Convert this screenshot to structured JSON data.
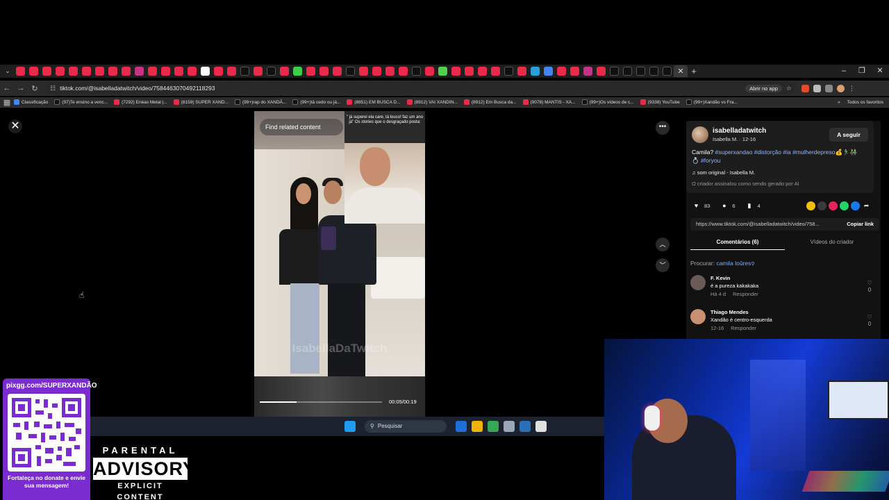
{
  "browser": {
    "url": "tiktok.com/@isabelladatwitch/video/7584463070492118293",
    "open_app_label": "Abrir no app",
    "tab_colors": [
      "#ea2a4a",
      "#ea2a4a",
      "#ea2a4a",
      "#ea2a4a",
      "#ea2a4a",
      "#ea2a4a",
      "#ea2a4a",
      "#ea2a4a",
      "#ea2a4a",
      "#c13584",
      "#ea2a4a",
      "#ea2a4a",
      "#ea2a4a",
      "#ea2a4a",
      "#ffffff",
      "#ea2a4a",
      "#ea2a4a",
      "#111111",
      "#ea2a4a",
      "#111111",
      "#ea2a4a",
      "#3ecf4a",
      "#ea2a4a",
      "#ea2a4a",
      "#ea2a4a",
      "#111111",
      "#ea2a4a",
      "#ea2a4a",
      "#ea2a4a",
      "#ea2a4a",
      "#111111",
      "#ea2a4a",
      "#52d04b",
      "#ea2a4a",
      "#ea2a4a",
      "#ea2a4a",
      "#ea2a4a",
      "#111111",
      "#ea2a4a",
      "#2a9fd8",
      "#4285f4",
      "#ea2a4a",
      "#ea2a4a",
      "#c13584",
      "#ea2a4a",
      "#111111",
      "#111111",
      "#111111",
      "#111111",
      "#111111"
    ],
    "bookmarks": [
      {
        "label": "Classificação",
        "color": "#4285f4"
      },
      {
        "label": "(97)Te ensino a venc...",
        "color": "#111111"
      },
      {
        "label": "(7292) Enéas Metal |...",
        "color": "#ea2a4a"
      },
      {
        "label": "(8159) SUPER XAND...",
        "color": "#ea2a4a"
      },
      {
        "label": "(99+)rap do XANDÃ...",
        "color": "#111111"
      },
      {
        "label": "(99+)tá cedo ou já...",
        "color": "#111111"
      },
      {
        "label": "(8851) EM BUSCA D...",
        "color": "#ea2a4a"
      },
      {
        "label": "(8912) VAI XANDIN...",
        "color": "#ea2a4a"
      },
      {
        "label": "(8912) Em Busca da...",
        "color": "#ea2a4a"
      },
      {
        "label": "(9078) MANTIS - XA...",
        "color": "#ea2a4a"
      },
      {
        "label": "(99+)Os vídeos de c...",
        "color": "#111111"
      },
      {
        "label": "(9338) YouTube",
        "color": "#ea2a4a"
      },
      {
        "label": "(99+)Xandão vs Fra...",
        "color": "#111111"
      }
    ],
    "bookmarks_folder": "Todos os favoritos"
  },
  "video": {
    "find_related": "Find related content",
    "inset_caption": "\" já superei ela care, tá louco! faz um ano já\" Os stories que o desgraçado posta:",
    "watermark": "IsabellaDaTwitch",
    "time": "00:05/00:19",
    "progress": 0.3
  },
  "panel": {
    "username": "isabelladatwitch",
    "subline": "Isabella M. · 12-16",
    "follow_label": "A seguir",
    "caption_text": "Camila? ",
    "hashtags": "#superxandao #distorção #ia #mulherdepreso💰🏃‍♂️👬 💍 #foryou",
    "sound": "♫  som original - Isabella M.",
    "ai_note": "O criador assinalou como sendo gerado por AI",
    "likes": "83",
    "comments_count": "6",
    "saves": "4",
    "link": "https://www.tiktok.com/@isabelladatwitch/video/758...",
    "copy_link": "Copiar link",
    "tab_comments": "Comentários (6)",
    "tab_creator": "Vídeos do criador",
    "search_prefix": "Procurar: ",
    "search_term": "camila loûres",
    "comments": [
      {
        "name": "F. Kevin",
        "text": "é a pureza kakakaka",
        "time": "Há 4 d",
        "reply": "Responder",
        "likes": "0",
        "color": "#6b5a55"
      },
      {
        "name": "Thiago Mendes",
        "text": "Xandão é centro-esquerda",
        "time": "12-16",
        "reply": "Responder",
        "likes": "0",
        "color": "#c89070"
      }
    ]
  },
  "taskbar": {
    "search_label": "Pesquisar",
    "icons": [
      "#1f6fd8",
      "#f0b400",
      "#34a853",
      "#9aa7b8",
      "#2b6fb8",
      "#e0e0e0"
    ]
  },
  "overlay": {
    "qr_title": "pixgg.com/SUPERXANDÃO",
    "qr_message": "Fortaleça no donate e envie sua mensagem!",
    "advisory_1": "PARENTAL",
    "advisory_2": "ADVISORY",
    "advisory_3": "EXPLICIT CONTENT"
  }
}
